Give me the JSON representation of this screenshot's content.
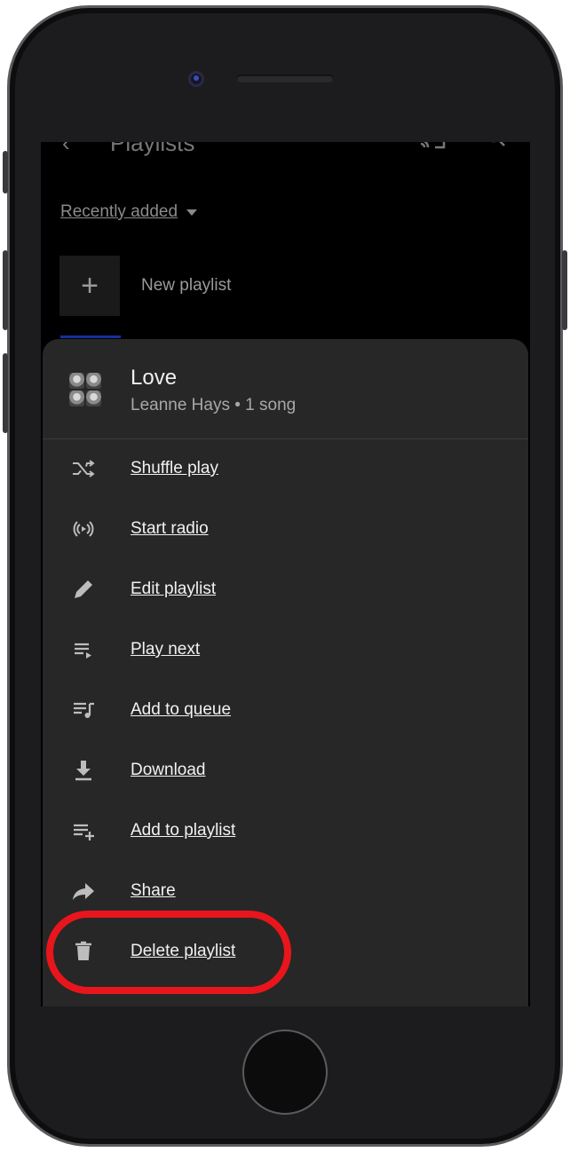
{
  "header": {
    "title": "Playlists"
  },
  "sort": {
    "label": "Recently added"
  },
  "new_playlist": {
    "label": "New playlist",
    "plus": "+"
  },
  "sheet": {
    "title": "Love",
    "subtitle": "Leanne Hays • 1 song",
    "items": [
      {
        "label": "Shuffle play",
        "icon": "shuffle-icon"
      },
      {
        "label": "Start radio",
        "icon": "radio-icon"
      },
      {
        "label": "Edit playlist",
        "icon": "pencil-icon"
      },
      {
        "label": "Play next",
        "icon": "play-next-icon"
      },
      {
        "label": "Add to queue",
        "icon": "queue-music-icon"
      },
      {
        "label": "Download",
        "icon": "download-icon"
      },
      {
        "label": "Add to playlist",
        "icon": "playlist-add-icon"
      },
      {
        "label": "Share",
        "icon": "share-icon"
      },
      {
        "label": "Delete playlist",
        "icon": "trash-icon"
      }
    ]
  },
  "colors": {
    "sheet_bg": "#272727",
    "highlight": "#e8161c",
    "screen_bg": "#000000"
  }
}
